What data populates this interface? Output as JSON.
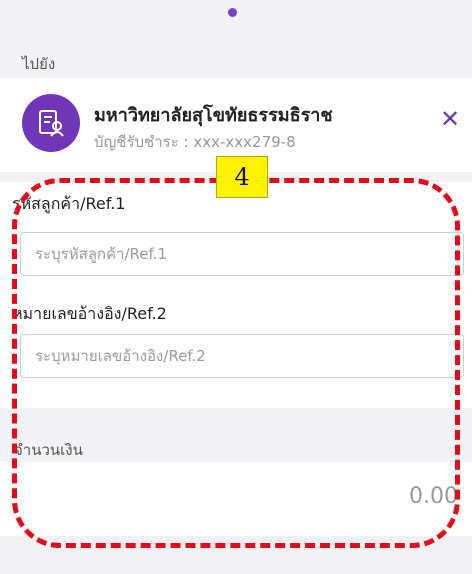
{
  "header": {
    "goto_label": "ไปยัง"
  },
  "payee": {
    "name": "มหาวิทยาลัยสุโขทัยธรรมธิราช",
    "account": "บัญชีรับชำระ : xxx-xxx279-8",
    "icon": "building-id-icon",
    "close_icon": "close-icon"
  },
  "form": {
    "ref1_label": "รหัสลูกค้า/Ref.1",
    "ref1_placeholder": "ระบุรหัสลูกค้า/Ref.1",
    "ref1_value": "",
    "ref2_label": "หมายเลขอ้างอิง/Ref.2",
    "ref2_placeholder": "ระบุหมายเลขอ้างอิง/Ref.2",
    "ref2_value": "",
    "amount_label": "จำนวนเงิน",
    "amount_value": "0.00"
  },
  "annotation": {
    "step_number": "4",
    "highlight_color": "#e30b17",
    "badge_color": "#fff200"
  },
  "colors": {
    "accent": "#6f37b8"
  }
}
